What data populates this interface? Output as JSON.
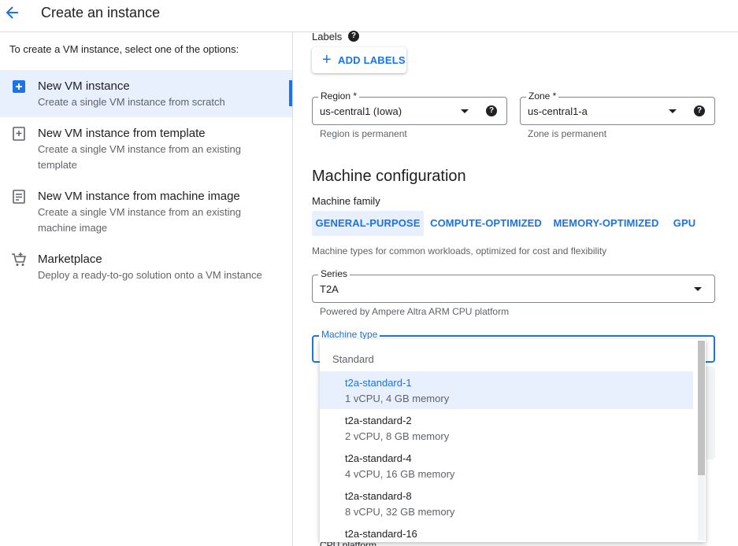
{
  "header": {
    "title": "Create an instance",
    "back_icon": "arrow-left-icon"
  },
  "left_panel": {
    "intro": "To create a VM instance, select one of the options:",
    "options": [
      {
        "title": "New VM instance",
        "desc": "Create a single VM instance from scratch",
        "icon": "add-box-icon",
        "active": true
      },
      {
        "title": "New VM instance from template",
        "desc": "Create a single VM instance from an existing template",
        "icon": "template-add-icon",
        "active": false
      },
      {
        "title": "New VM instance from machine image",
        "desc": "Create a single VM instance from an existing machine image",
        "icon": "machine-image-icon",
        "active": false
      },
      {
        "title": "Marketplace",
        "desc": "Deploy a ready-to-go solution onto a VM instance",
        "icon": "cart-icon",
        "active": false
      }
    ]
  },
  "labels": {
    "heading": "Labels",
    "add_button": "ADD LABELS",
    "help": "?"
  },
  "region": {
    "label": "Region *",
    "value": "us-central1 (Iowa)",
    "hint": "Region is permanent"
  },
  "zone": {
    "label": "Zone *",
    "value": "us-central1-a",
    "hint": "Zone is permanent"
  },
  "machine_config": {
    "title": "Machine configuration",
    "family_label": "Machine family",
    "families": [
      "GENERAL-PURPOSE",
      "COMPUTE-OPTIMIZED",
      "MEMORY-OPTIMIZED",
      "GPU"
    ],
    "family_hint": "Machine types for common workloads, optimized for cost and flexibility",
    "series_label": "Series",
    "series_value": "T2A",
    "series_hint": "Powered by Ampere Altra ARM CPU platform",
    "machine_type_label": "Machine type",
    "cpu_platform_label": "CPU platform"
  },
  "dropdown": {
    "group": "Standard",
    "items": [
      {
        "name": "t2a-standard-1",
        "spec": "1 vCPU, 4 GB memory",
        "selected": true
      },
      {
        "name": "t2a-standard-2",
        "spec": "2 vCPU, 8 GB memory",
        "selected": false
      },
      {
        "name": "t2a-standard-4",
        "spec": "4 vCPU, 16 GB memory",
        "selected": false
      },
      {
        "name": "t2a-standard-8",
        "spec": "8 vCPU, 32 GB memory",
        "selected": false
      },
      {
        "name": "t2a-standard-16",
        "spec": "",
        "selected": false
      }
    ]
  },
  "colors": {
    "accent": "#1a73e8",
    "selected_bg": "#e8f0fe",
    "text": "#202124",
    "muted": "#5f6368"
  }
}
